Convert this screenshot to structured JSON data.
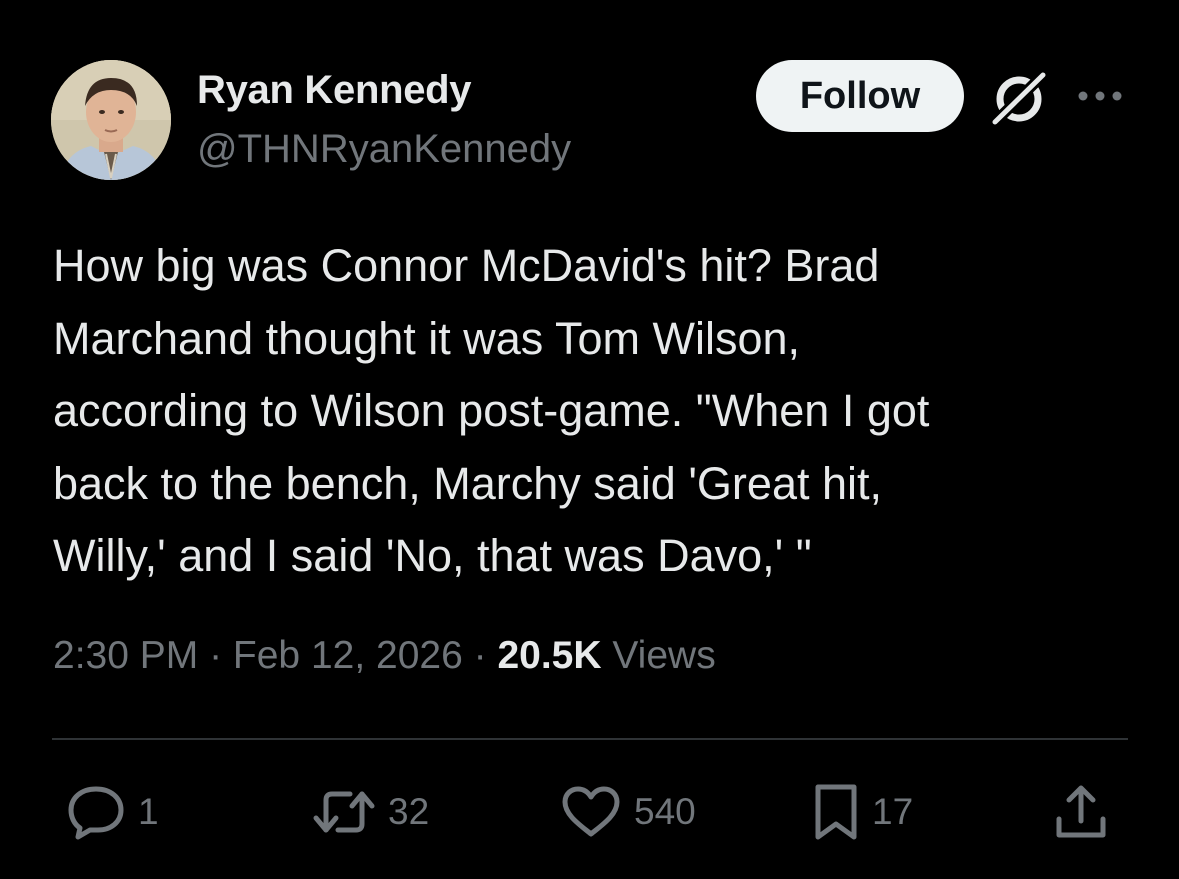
{
  "author": {
    "display_name": "Ryan Kennedy",
    "handle": "@THNRyanKennedy"
  },
  "header": {
    "follow_label": "Follow",
    "grok_icon": "grok-icon",
    "more_icon": "more-options-icon"
  },
  "tweet": {
    "text": "How big was Connor McDavid's hit? Brad\nMarchand thought it was Tom Wilson,\naccording to Wilson post-game. \"When I got\nback to the bench, Marchy said 'Great hit,\nWilly,' and I said 'No, that was Davo,' \""
  },
  "meta": {
    "time": "2:30 PM",
    "separator": " · ",
    "date": "Feb 12, 2026",
    "views_count": "20.5K",
    "views_label": " Views"
  },
  "actions": {
    "replies": "1",
    "reposts": "32",
    "likes": "540",
    "bookmarks": "17"
  },
  "colors": {
    "background": "#000000",
    "primary_text": "#e7e9ea",
    "secondary_text": "#71767b",
    "divider": "#2f3336",
    "follow_bg": "#eff3f4"
  }
}
